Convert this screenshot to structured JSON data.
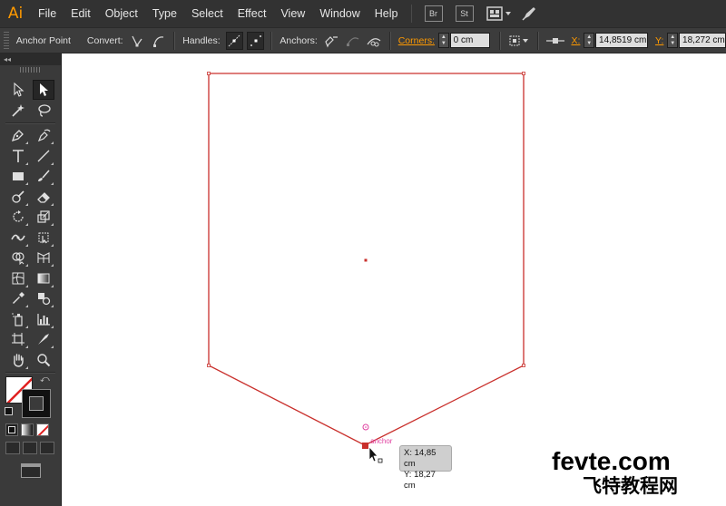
{
  "app": {
    "logo": "Ai"
  },
  "menu": {
    "items": [
      "File",
      "Edit",
      "Object",
      "Type",
      "Select",
      "Effect",
      "View",
      "Window",
      "Help"
    ],
    "bridge_label": "Br",
    "stock_label": "St"
  },
  "controlbar": {
    "tool_name": "Anchor Point",
    "convert_label": "Convert:",
    "handles_label": "Handles:",
    "anchors_label": "Anchors:",
    "corners_label": "Corners:",
    "corners_value": "0 cm",
    "x_label": "X:",
    "x_value": "14,8519 cm",
    "y_label": "Y:",
    "y_value": "18,272 cm"
  },
  "tools": {
    "collapse_glyph": "◂◂"
  },
  "canvas": {
    "smart_guide_label": "anchor",
    "tooltip": {
      "x_line": "X: 14,85 cm",
      "y_line": "Y: 18,27 cm"
    },
    "path_color": "#c9302c",
    "guide_color": "#e040a0"
  },
  "watermark": {
    "latin": "fevte.com",
    "chinese": "飞特教程网"
  }
}
